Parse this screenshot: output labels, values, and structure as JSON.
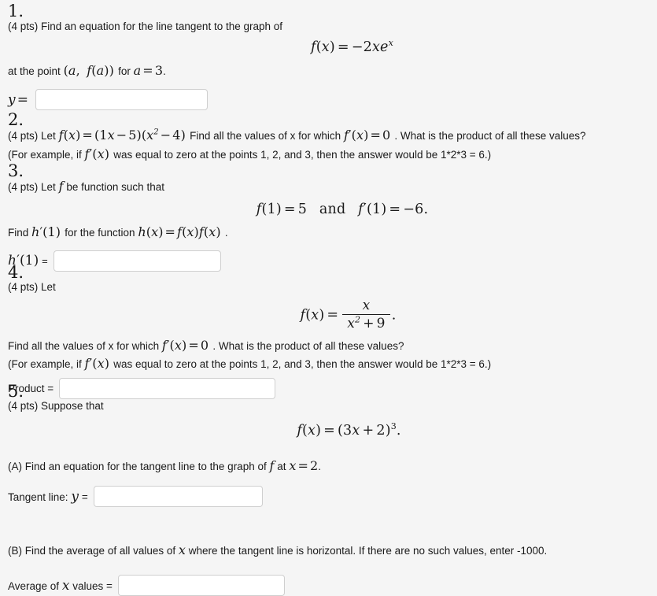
{
  "page": {
    "background_color": "#f5f5f5",
    "text_color": "#1a1a1a",
    "input_background": "#ffffff",
    "input_border_color": "#cfcfcf"
  },
  "problems": [
    {
      "number": "1.",
      "points_label": "(4 pts)",
      "prompt_line1": "Find an equation for the line tangent to the graph of",
      "display_equation": "f(x) = -2xe^x",
      "prompt_line2_pre": "at the point",
      "prompt_line2_point": "(a, f(a))",
      "prompt_line2_mid": "for",
      "prompt_line2_condition": "a = 3",
      "prompt_line2_post": ".",
      "answer_label": "y =",
      "answer_value": "",
      "answer_placeholder": ""
    },
    {
      "number": "2.",
      "points_label": "(4 pts)",
      "prompt_pre": "Let",
      "function_definition": "f(x) = (1x - 5)(x^2 - 4)",
      "prompt_mid": "Find all the values of x for which",
      "condition": "f'(x) = 0",
      "prompt_post": ". What is the product of all these values?",
      "example_pre": "(For example, if",
      "example_math": "f'(x)",
      "example_post": "was equal to zero at the points 1, 2, and 3, then the answer would be 1*2*3 = 6.)"
    },
    {
      "number": "3.",
      "points_label": "(4 pts)",
      "prompt_pre": "Let",
      "prompt_fn": "f",
      "prompt_post": "be function such that",
      "display_equation": "f(1) = 5   and   f'(1) = -6.",
      "find_pre": "Find",
      "find_math": "h'(1)",
      "find_mid": "for the function",
      "find_fn": "h(x) = f(x)f(x)",
      "find_post": ".",
      "answer_label": "h'(1) =",
      "answer_value": "",
      "answer_placeholder": ""
    },
    {
      "number": "4.",
      "points_label": "(4 pts)",
      "prompt_pre": "Let",
      "display_numerator": "x",
      "display_denominator": "x^2 + 9",
      "display_lhs": "f(x) =",
      "find_pre": "Find all the values of x for which",
      "find_condition": "f'(x) = 0",
      "find_post": ". What is the product of all these values?",
      "example_pre": "(For example, if",
      "example_math": "f'(x)",
      "example_post": "was equal to zero at the points 1, 2, and 3, then the answer would be 1*2*3 = 6.)",
      "answer_label": "Product =",
      "answer_value": "",
      "answer_placeholder": ""
    },
    {
      "number": "5.",
      "points_label": "(4 pts)",
      "prompt_pre": "Suppose that",
      "display_equation": "f(x) = (3x + 2)^3.",
      "part_a_pre": "(A) Find an equation for the tangent line to the graph of",
      "part_a_fn": "f",
      "part_a_mid": "at",
      "part_a_condition": "x = 2",
      "part_a_post": ".",
      "part_a_answer_label_pre": "Tangent line:",
      "part_a_answer_label_math": "y",
      "part_a_answer_label_post": "=",
      "part_a_answer_value": "",
      "part_b_pre": "(B) Find the average of all values of",
      "part_b_math": "x",
      "part_b_post": "where the tangent line is horizontal. If there are no such values, enter -1000.",
      "part_b_answer_label_pre": "Average of",
      "part_b_answer_label_math": "x",
      "part_b_answer_label_post": "values =",
      "part_b_answer_value": ""
    }
  ]
}
